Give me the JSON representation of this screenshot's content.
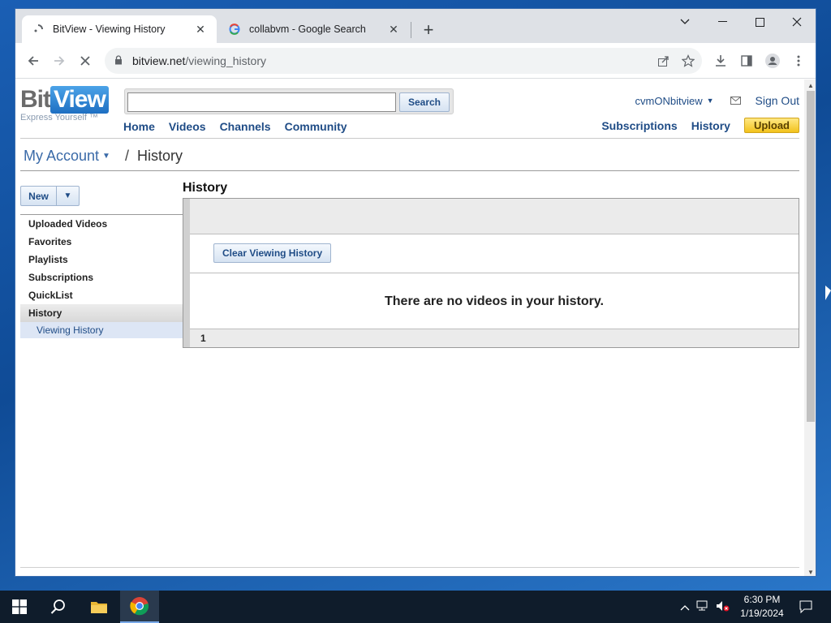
{
  "browser": {
    "tabs": [
      {
        "title": "BitView - Viewing History",
        "active": true
      },
      {
        "title": "collabvm - Google Search",
        "active": false
      }
    ],
    "url_host": "bitview.net",
    "url_path": "/viewing_history"
  },
  "site": {
    "logo_bit": "Bit",
    "logo_view": "View",
    "tagline": "Express Yourself ™",
    "search_placeholder": "",
    "search_button": "Search",
    "main_nav": [
      "Home",
      "Videos",
      "Channels",
      "Community"
    ],
    "username": "cvmONbitview",
    "sign_out": "Sign Out",
    "right_nav": [
      "Subscriptions",
      "History"
    ],
    "upload": "Upload"
  },
  "breadcrumb": {
    "root": "My Account",
    "separator": "/",
    "current": "History"
  },
  "sidebar": {
    "new_button": "New",
    "items": [
      {
        "label": "Uploaded Videos"
      },
      {
        "label": "Favorites"
      },
      {
        "label": "Playlists"
      },
      {
        "label": "Subscriptions"
      },
      {
        "label": "QuickList"
      },
      {
        "label": "History",
        "selected": true
      }
    ],
    "sub_item": "Viewing History"
  },
  "content": {
    "title": "History",
    "clear_button": "Clear Viewing History",
    "empty_message": "There are no videos in your history.",
    "page_number": "1"
  },
  "taskbar": {
    "time": "6:30 PM",
    "date": "1/19/2024"
  },
  "colors": {
    "link": "#1f4c86",
    "upload": "#f2c21c",
    "taskbar": "#0f1c2b"
  }
}
